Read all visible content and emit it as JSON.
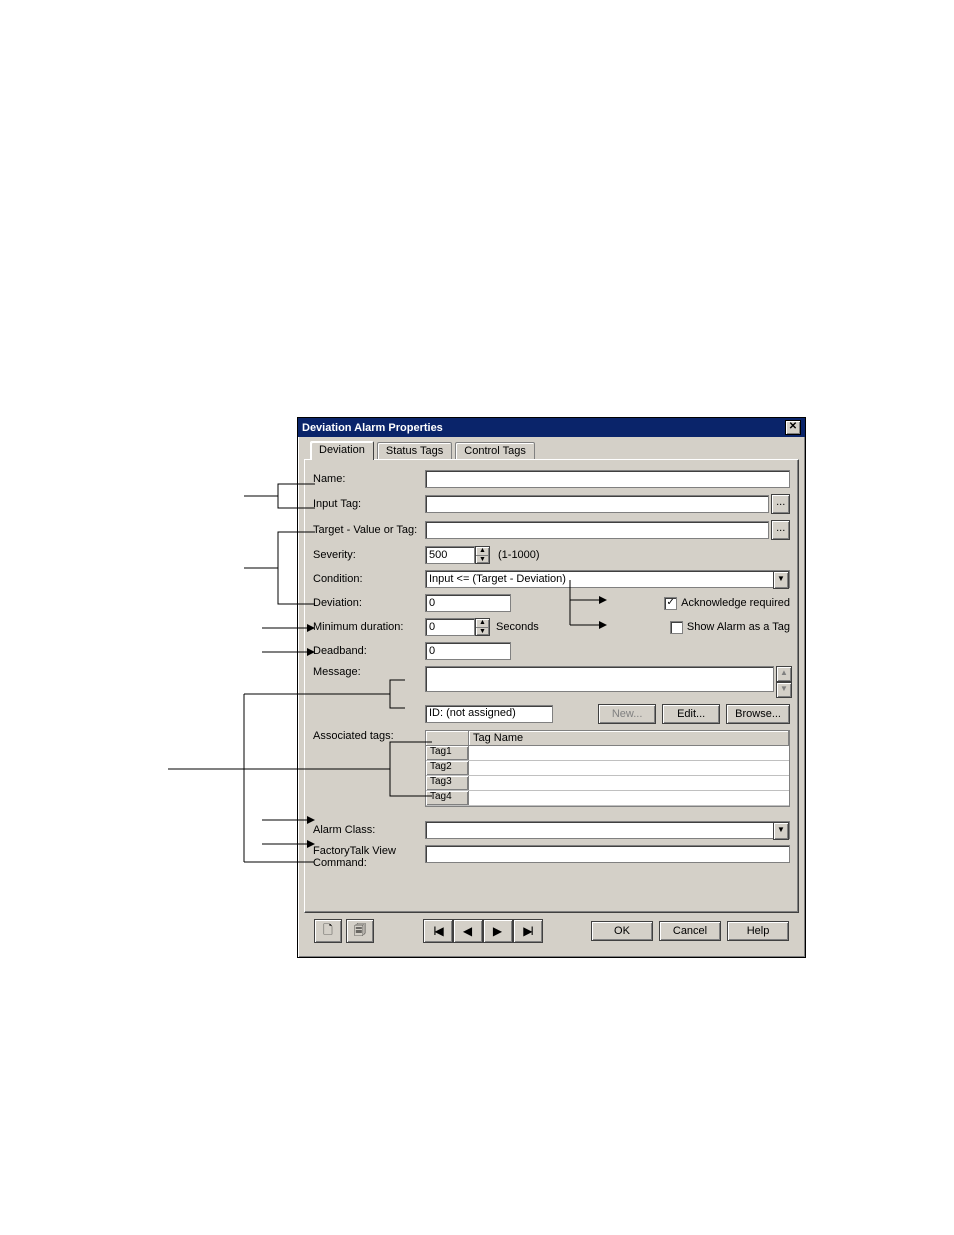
{
  "dialog": {
    "title": "Deviation Alarm Properties",
    "close_glyph": "✕"
  },
  "tabs": {
    "deviation": "Deviation",
    "status": "Status Tags",
    "control": "Control Tags"
  },
  "labels": {
    "name": "Name:",
    "input_tag": "Input Tag:",
    "target": "Target - Value or Tag:",
    "severity": "Severity:",
    "severity_range": "(1-1000)",
    "condition": "Condition:",
    "deviation": "Deviation:",
    "min_duration": "Minimum duration:",
    "seconds": "Seconds",
    "deadband": "Deadband:",
    "message": "Message:",
    "message_id": "ID: (not assigned)",
    "associated": "Associated tags:",
    "alarm_class": "Alarm Class:",
    "ft_command": "FactoryTalk View\nCommand:",
    "tag_name_header": "Tag Name"
  },
  "values": {
    "name": "",
    "input_tag": "",
    "target": "",
    "severity": "500",
    "condition": "Input <= (Target - Deviation)",
    "deviation": "0",
    "min_duration": "0",
    "deadband": "0",
    "message": "",
    "alarm_class": "",
    "ft_command": ""
  },
  "checkboxes": {
    "ack_required": {
      "label": "Acknowledge required",
      "checked": true
    },
    "show_as_tag": {
      "label": "Show Alarm as a Tag",
      "checked": false
    }
  },
  "msg_buttons": {
    "new": "New...",
    "edit": "Edit...",
    "browse": "Browse..."
  },
  "tag_rows": [
    "Tag1",
    "Tag2",
    "Tag3",
    "Tag4"
  ],
  "bottom": {
    "ok": "OK",
    "cancel": "Cancel",
    "help": "Help"
  },
  "glyphs": {
    "ellipsis": "...",
    "up": "▲",
    "down": "▼",
    "dropdown": "▼",
    "check": "✓",
    "first": "I◀",
    "prev": "◀",
    "next": "▶",
    "last": "▶I",
    "new_doc": "🗋",
    "copy_doc": "🗐"
  }
}
